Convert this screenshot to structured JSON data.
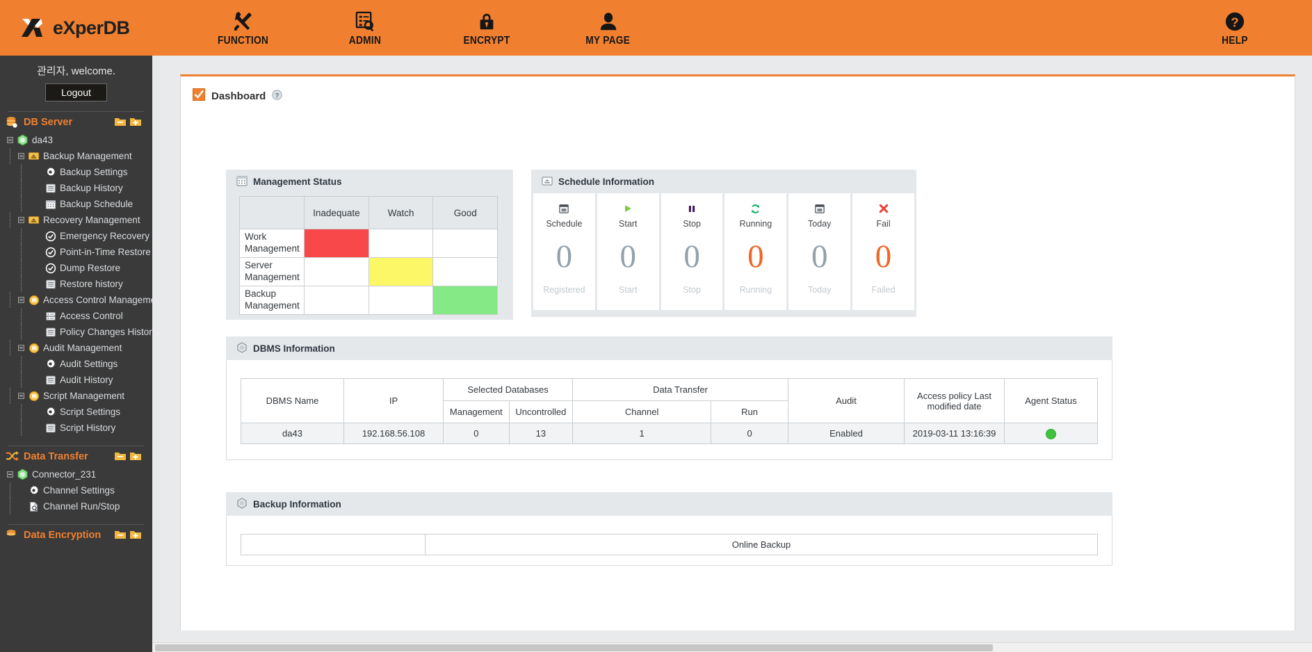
{
  "brand": {
    "name": "eXperDB",
    "logo_icon": "experdb-logo-icon"
  },
  "topnav": {
    "items": [
      {
        "label": "FUNCTION",
        "icon": "wrench-screwdriver-icon"
      },
      {
        "label": "ADMIN",
        "icon": "clipboard-search-icon"
      },
      {
        "label": "ENCRYPT",
        "icon": "lock-icon"
      },
      {
        "label": "MY PAGE",
        "icon": "user-icon"
      }
    ],
    "help": {
      "label": "HELP",
      "icon": "question-circle-icon"
    }
  },
  "sidebar": {
    "welcome": "관리자, welcome.",
    "logout_label": "Logout",
    "groups": [
      {
        "label": "DB Server",
        "icon": "database-icon",
        "buttons": [
          "folder-collapse-icon",
          "folder-add-icon"
        ],
        "nodes": [
          {
            "label": "da43",
            "icon": "cube-icon",
            "level": 1,
            "expander": true
          },
          {
            "label": "Backup Management",
            "icon": "archive-icon",
            "level": 2,
            "expander": true
          },
          {
            "label": "Backup Settings",
            "icon": "gear-icon",
            "level": 3,
            "expander": false
          },
          {
            "label": "Backup History",
            "icon": "list-icon",
            "level": 3,
            "expander": false
          },
          {
            "label": "Backup Schedule",
            "icon": "calendar-icon",
            "level": 3,
            "expander": false
          },
          {
            "label": "Recovery Management",
            "icon": "archive-icon",
            "level": 2,
            "expander": true
          },
          {
            "label": "Emergency Recovery",
            "icon": "check-circle-icon",
            "level": 3,
            "expander": false
          },
          {
            "label": "Point-in-Time Restore",
            "icon": "check-circle-icon",
            "level": 3,
            "expander": false
          },
          {
            "label": "Dump Restore",
            "icon": "check-circle-icon",
            "level": 3,
            "expander": false
          },
          {
            "label": "Restore history",
            "icon": "list-icon",
            "level": 3,
            "expander": false
          },
          {
            "label": "Access Control Management",
            "icon": "hand-icon",
            "level": 2,
            "expander": true
          },
          {
            "label": "Access Control",
            "icon": "server-icon",
            "level": 3,
            "expander": false
          },
          {
            "label": "Policy Changes History",
            "icon": "list-icon",
            "level": 3,
            "expander": false
          },
          {
            "label": "Audit Management",
            "icon": "hand-icon",
            "level": 2,
            "expander": true
          },
          {
            "label": "Audit Settings",
            "icon": "gear-icon",
            "level": 3,
            "expander": false
          },
          {
            "label": "Audit History",
            "icon": "list-icon",
            "level": 3,
            "expander": false
          },
          {
            "label": "Script Management",
            "icon": "hand-icon",
            "level": 2,
            "expander": true
          },
          {
            "label": "Script Settings",
            "icon": "gear-icon",
            "level": 3,
            "expander": false
          },
          {
            "label": "Script History",
            "icon": "list-icon",
            "level": 3,
            "expander": false
          }
        ]
      },
      {
        "label": "Data Transfer",
        "icon": "transfer-arrows-icon",
        "buttons": [
          "folder-collapse-icon",
          "folder-add-icon"
        ],
        "nodes": [
          {
            "label": "Connector_231",
            "icon": "cube-icon",
            "level": 1,
            "expander": true
          },
          {
            "label": "Channel Settings",
            "icon": "gear-icon",
            "level": 2,
            "expander": false
          },
          {
            "label": "Channel Run/Stop",
            "icon": "doc-search-icon",
            "level": 2,
            "expander": false
          }
        ]
      },
      {
        "label": "Data Encryption",
        "icon": "database-icon",
        "buttons": [
          "folder-collapse-icon",
          "folder-add-icon"
        ],
        "nodes": []
      }
    ]
  },
  "page": {
    "title": "Dashboard",
    "title_icon": "checkbox-orange-icon",
    "help_icon": "help-circle-icon"
  },
  "management_status": {
    "title": "Management Status",
    "icon": "calendar-board-icon",
    "columns": [
      "",
      "Inadequate",
      "Watch",
      "Good"
    ],
    "rows": [
      {
        "label": "Work Management",
        "status": "Inadequate",
        "color": "#f9484a"
      },
      {
        "label": "Server Management",
        "status": "Watch",
        "color": "#fbf767"
      },
      {
        "label": "Backup Management",
        "status": "Good",
        "color": "#85ea85"
      }
    ]
  },
  "schedule_information": {
    "title": "Schedule Information",
    "icon": "archive-icon",
    "cards": [
      {
        "label": "Schedule",
        "icon": "calendar-icon",
        "value": "0",
        "footer": "Registered",
        "accent": false
      },
      {
        "label": "Start",
        "icon": "play-icon",
        "value": "0",
        "footer": "Start",
        "accent": false
      },
      {
        "label": "Stop",
        "icon": "pause-icon",
        "value": "0",
        "footer": "Stop",
        "accent": false
      },
      {
        "label": "Running",
        "icon": "refresh-icon",
        "value": "0",
        "footer": "Running",
        "accent": true
      },
      {
        "label": "Today",
        "icon": "calendar-icon",
        "value": "0",
        "footer": "Today",
        "accent": false
      },
      {
        "label": "Fail",
        "icon": "x-red-icon",
        "value": "0",
        "footer": "Failed",
        "accent": true
      }
    ]
  },
  "dbms_information": {
    "title": "DBMS Information",
    "icon": "hexagon-icon",
    "headers": {
      "dbms_name": "DBMS Name",
      "ip": "IP",
      "selected_databases": "Selected Databases",
      "management": "Management",
      "uncontrolled": "Uncontrolled",
      "data_transfer": "Data Transfer",
      "channel": "Channel",
      "run": "Run",
      "audit": "Audit",
      "access_policy": "Access policy Last modified date",
      "agent_status": "Agent Status"
    },
    "rows": [
      {
        "dbms_name": "da43",
        "ip": "192.168.56.108",
        "management": "0",
        "uncontrolled": "13",
        "channel": "1",
        "run": "0",
        "audit": "Enabled",
        "access_policy": "2019-03-11 13:16:39",
        "agent_status": "online"
      }
    ]
  },
  "backup_information": {
    "title": "Backup Information",
    "icon": "hexagon-icon",
    "headers": [
      "",
      "Online Backup"
    ]
  },
  "colors": {
    "brand_orange": "#f08030",
    "accent_orange": "#f26522",
    "status_inadequate": "#f9484a",
    "status_watch": "#fbf767",
    "status_good": "#85ea85",
    "agent_online": "#3ec43e"
  }
}
